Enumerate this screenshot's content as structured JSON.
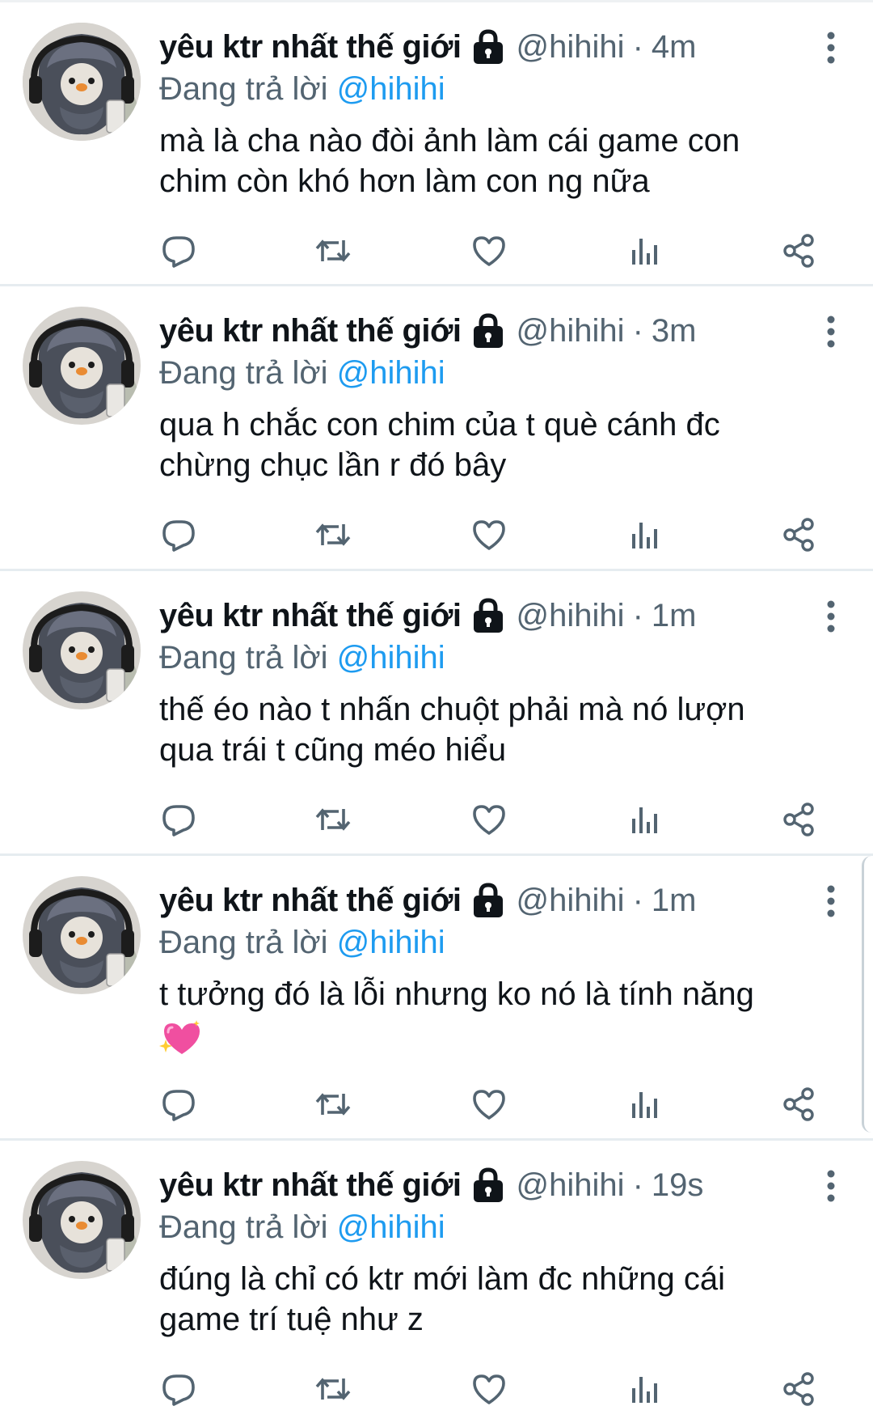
{
  "colors": {
    "text_primary": "#0f1419",
    "text_secondary": "#536471",
    "accent": "#1d9bf0",
    "divider": "#e6ecf0"
  },
  "tweets": [
    {
      "display_name": "yêu ktr nhất thế giới",
      "protected_icon": "lock-icon",
      "handle": "@hihihi",
      "separator": "·",
      "time": "4m",
      "reply_prefix": "Đang trả lời ",
      "reply_mention": "@hihihi",
      "text": "mà là cha nào đòi ảnh làm cái game con\nchim còn khó hơn làm con ng nữa",
      "emoji": ""
    },
    {
      "display_name": "yêu ktr nhất thế giới",
      "protected_icon": "lock-icon",
      "handle": "@hihihi",
      "separator": "·",
      "time": "3m",
      "reply_prefix": "Đang trả lời ",
      "reply_mention": "@hihihi",
      "text": "qua h chắc con chim của t què cánh đc\nchừng chục lần r đó bây",
      "emoji": ""
    },
    {
      "display_name": "yêu ktr nhất thế giới",
      "protected_icon": "lock-icon",
      "handle": "@hihihi",
      "separator": "·",
      "time": "1m",
      "reply_prefix": "Đang trả lời ",
      "reply_mention": "@hihihi",
      "text": "thế éo nào t nhấn chuột phải mà nó lượn\nqua trái t cũng méo hiểu",
      "emoji": ""
    },
    {
      "display_name": "yêu ktr nhất thế giới",
      "protected_icon": "lock-icon",
      "handle": "@hihihi",
      "separator": "·",
      "time": "1m",
      "reply_prefix": "Đang trả lời ",
      "reply_mention": "@hihihi",
      "text": "t tưởng đó là lỗi nhưng ko nó là tính năng\n",
      "emoji": "sparkling-heart-icon"
    },
    {
      "display_name": "yêu ktr nhất thế giới",
      "protected_icon": "lock-icon",
      "handle": "@hihihi",
      "separator": "·",
      "time": "19s",
      "reply_prefix": "Đang trả lời ",
      "reply_mention": "@hihihi",
      "text": "đúng là chỉ có ktr mới làm đc những cái\ngame trí tuệ như z",
      "emoji": ""
    }
  ],
  "action_icons": [
    "reply-icon",
    "retweet-icon",
    "like-icon",
    "views-icon",
    "share-icon"
  ]
}
